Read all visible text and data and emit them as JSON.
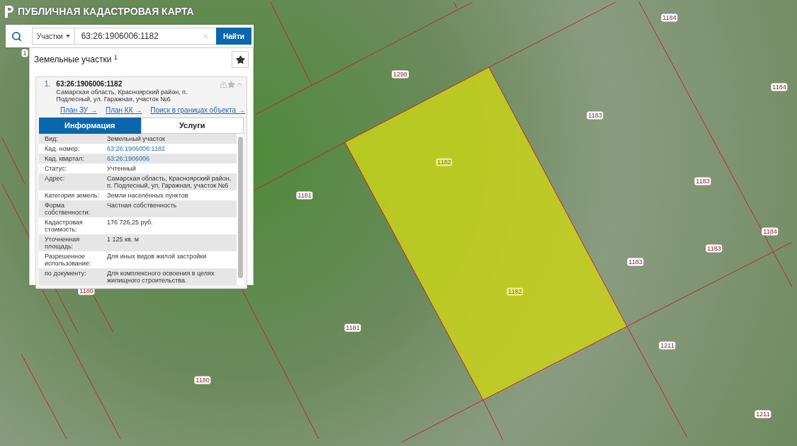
{
  "app": {
    "title": "ПУБЛИЧНАЯ КАДАСТРОВАЯ КАРТА"
  },
  "search": {
    "category": "Участки",
    "value": "63:26:1906006:1182",
    "button": "Найти"
  },
  "results": {
    "title": "Земельные участки $^{1}$",
    "items": [
      {
        "index": "1.",
        "number": "63:26:1906006:1182",
        "address": "Самарская область, Красноярский район, п. Подлесный, ул. Гаражная, участок №6",
        "expanded": true,
        "links": [
          "План ЗУ →",
          "План КК →",
          "Поиск в границах объекта →"
        ],
        "tabs": [
          {
            "label": "Информация",
            "selected": true
          },
          {
            "label": "Услуги",
            "selected": false
          }
        ],
        "fields": [
          {
            "label": "Вид:",
            "value": "Земельный участок",
            "kind": "text"
          },
          {
            "label": "Кад. номер:",
            "value": "63:26:1906006:1182",
            "kind": "link"
          },
          {
            "label": "Кад. квартал:",
            "value": "63:26:1906006",
            "kind": "link"
          },
          {
            "label": "Статус:",
            "value": "Учтенный",
            "kind": "text"
          },
          {
            "label": "Адрес:",
            "value": "Самарская область, Красноярский район, п. Подлесный, ул. Гаражная, участок №6",
            "kind": "text"
          },
          {
            "label": "Категория земель:",
            "value": "Земли населённых пунктов",
            "kind": "text"
          },
          {
            "label": "Форма собственности:",
            "value": "Частная собственность",
            "kind": "text"
          },
          {
            "label": "Кадастровая стоимость:",
            "value": "176 726,25 руб.",
            "kind": "text"
          },
          {
            "label": "Уточненная площадь:",
            "value": "1 125 кв. м",
            "kind": "text"
          },
          {
            "label": "Разрешенное использование:",
            "value": "Для иных видов жилой застройки",
            "kind": "text"
          },
          {
            "label": "по документу:",
            "value": "Для комплексного освоения в целях жилищного строительства.",
            "kind": "text"
          }
        ]
      }
    ]
  },
  "map": {
    "labels": [
      {
        "text": "1",
        "selected": false
      },
      {
        "text": "1298",
        "selected": false
      },
      {
        "text": "1184",
        "selected": false
      },
      {
        "text": "1184",
        "selected": false
      },
      {
        "text": "1183",
        "selected": false
      },
      {
        "text": "1182",
        "selected": true
      },
      {
        "text": "1181",
        "selected": false
      },
      {
        "text": "1183",
        "selected": false
      },
      {
        "text": "1184",
        "selected": false
      },
      {
        "text": "1183",
        "selected": false
      },
      {
        "text": "1183",
        "selected": false
      },
      {
        "text": "1180",
        "selected": false
      },
      {
        "text": "1182",
        "selected": true
      },
      {
        "text": "1181",
        "selected": false
      },
      {
        "text": "1211",
        "selected": false
      },
      {
        "text": "1180",
        "selected": false
      },
      {
        "text": "1211",
        "selected": false
      }
    ]
  }
}
